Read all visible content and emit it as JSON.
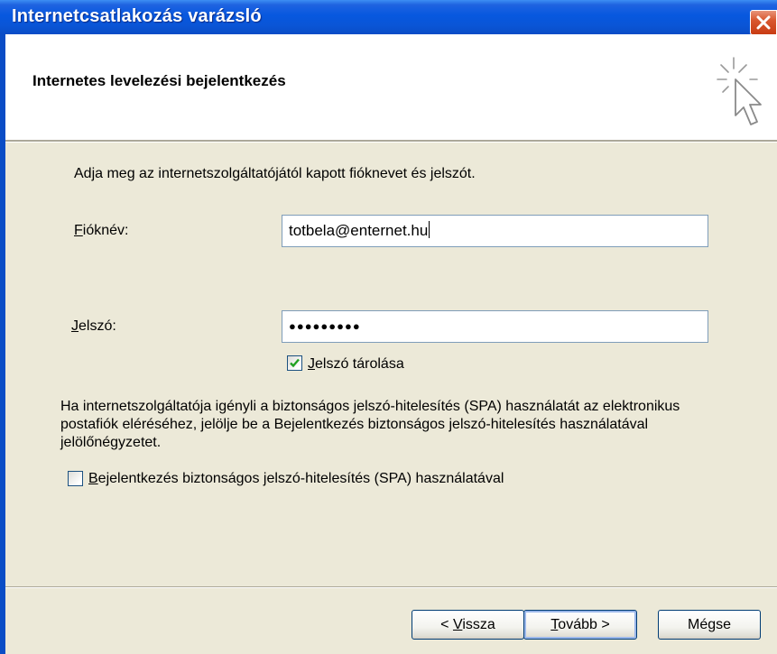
{
  "window": {
    "title": "Internetcsatlakozás varázsló",
    "header_title": "Internetes levelezési bejelentkezés"
  },
  "form": {
    "intro": "Adja meg az internetszolgáltatójától kapott fióknevet és jelszót.",
    "account_label_mnemonic": "F",
    "account_label_rest": "ióknév:",
    "account_value": "totbela@enternet.hu",
    "password_label_mnemonic": "J",
    "password_label_rest": "elszó:",
    "password_value": "●●●●●●●●●",
    "remember_mnemonic": "J",
    "remember_rest": "elszó tárolása",
    "remember_checked": true,
    "spa_description": "Ha internetszolgáltatója igényli a biztonságos jelszó-hitelesítés (SPA) használatát az elektronikus postafiók eléréséhez, jelölje be a Bejelentkezés biztonságos jelszó-hitelesítés használatával jelölőnégyzetet.",
    "spa_checkbox_mnemonic": "B",
    "spa_checkbox_rest": "ejelentkezés biztonságos jelszó-hitelesítés (SPA) használatával",
    "spa_checked": false
  },
  "buttons": {
    "back_prefix": "< ",
    "back_mnemonic": "V",
    "back_rest": "issza",
    "next_mnemonic": "T",
    "next_rest": "ovább >",
    "cancel": "Mégse"
  },
  "colors": {
    "titlebar": "#0a55d6",
    "face": "#ece9d8",
    "close_button": "#d9582f",
    "checkmark": "#21a121"
  },
  "icons": {
    "close": "close-icon",
    "wizard": "cursor-sparkle-icon",
    "check": "checkmark-icon"
  }
}
